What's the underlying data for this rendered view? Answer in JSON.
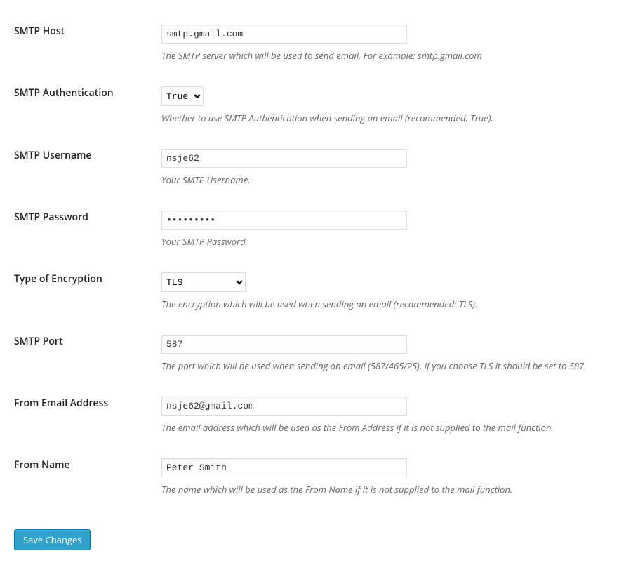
{
  "fields": {
    "smtp_host": {
      "label": "SMTP Host",
      "value": "smtp.gmail.com",
      "description": "The SMTP server which will be used to send email. For example: smtp.gmail.com"
    },
    "smtp_auth": {
      "label": "SMTP Authentication",
      "value": "True",
      "description": "Whether to use SMTP Authentication when sending an email (recommended: True)."
    },
    "smtp_username": {
      "label": "SMTP Username",
      "value": "nsje62",
      "description": "Your SMTP Username."
    },
    "smtp_password": {
      "label": "SMTP Password",
      "value": "•••••••••",
      "description": "Your SMTP Password."
    },
    "encryption": {
      "label": "Type of Encryption",
      "value": "TLS",
      "description": "The encryption which will be used when sending an email (recommended: TLS)."
    },
    "smtp_port": {
      "label": "SMTP Port",
      "value": "587",
      "description": "The port which will be used when sending an email (587/465/25). If you choose TLS it should be set to 587."
    },
    "from_email": {
      "label": "From Email Address",
      "value": "nsje62@gmail.com",
      "description": "The email address which will be used as the From Address if it is not supplied to the mail function."
    },
    "from_name": {
      "label": "From Name",
      "value": "Peter Smith",
      "description": "The name which will be used as the From Name if it is not supplied to the mail function."
    }
  },
  "submit": {
    "save_label": "Save Changes"
  }
}
